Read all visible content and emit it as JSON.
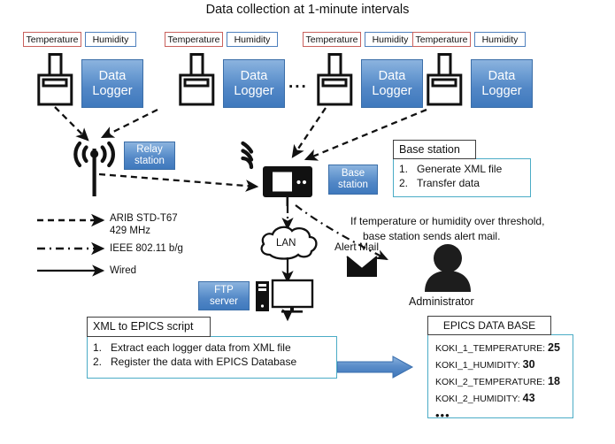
{
  "title": "Data collection at 1-minute intervals",
  "colors": {
    "temp_border": "#c9615d",
    "hum_border": "#4f81bd",
    "blue_box": "#5287c6",
    "callout_border": "#4bacc6",
    "header_border": "#3f3f3f",
    "arrow_blue": "#4a80c0",
    "ink": "#111111"
  },
  "sensor_groups": [
    {
      "temperature": "Temperature",
      "humidity": "Humidity",
      "logger_line1": "Data",
      "logger_line2": "Logger"
    },
    {
      "temperature": "Temperature",
      "humidity": "Humidity",
      "logger_line1": "Data",
      "logger_line2": "Logger"
    },
    {
      "temperature": "Temperature",
      "humidity": "Humidity",
      "logger_line1": "Data",
      "logger_line2": "Logger"
    },
    {
      "temperature": "Temperature",
      "humidity": "Humidity",
      "logger_line1": "Data",
      "logger_line2": "Logger"
    }
  ],
  "ellipsis": "...",
  "relay": {
    "line1": "Relay",
    "line2": "station"
  },
  "base_label": {
    "line1": "Base",
    "line2": "station"
  },
  "base_callout": {
    "header": "Base station",
    "items": [
      {
        "num": "1.",
        "text": "Generate XML file"
      },
      {
        "num": "2.",
        "text": "Transfer data"
      }
    ]
  },
  "legend": [
    {
      "style": "dashed",
      "lines": [
        "ARIB STD-T67",
        "429 MHz"
      ]
    },
    {
      "style": "dashdot",
      "lines": [
        "IEEE 802.11 b/g"
      ]
    },
    {
      "style": "solid",
      "lines": [
        "Wired"
      ]
    }
  ],
  "lan_label": "LAN",
  "ftp": {
    "line1": "FTP",
    "line2": "server"
  },
  "alert": {
    "mail_label": "Alert Mail",
    "note_line1": "If temperature or humidity over threshold,",
    "note_line2": "base station sends  alert mail.",
    "administrator": "Administrator"
  },
  "script_callout": {
    "header": "XML to EPICS  script",
    "items": [
      {
        "num": "1.",
        "text": "Extract each logger data from XML file"
      },
      {
        "num": "2.",
        "text": "Register the data with EPICS Database"
      }
    ]
  },
  "database": {
    "header": "EPICS DATA BASE",
    "rows": [
      {
        "key": "KOKI_1_TEMPERATURE:",
        "value": "25"
      },
      {
        "key": "KOKI_1_HUMIDITY:",
        "value": "30"
      },
      {
        "key": "KOKI_2_TEMPERATURE:",
        "value": "18"
      },
      {
        "key": "KOKI_2_HUMIDITY:",
        "value": "43"
      }
    ],
    "more": "•••"
  }
}
